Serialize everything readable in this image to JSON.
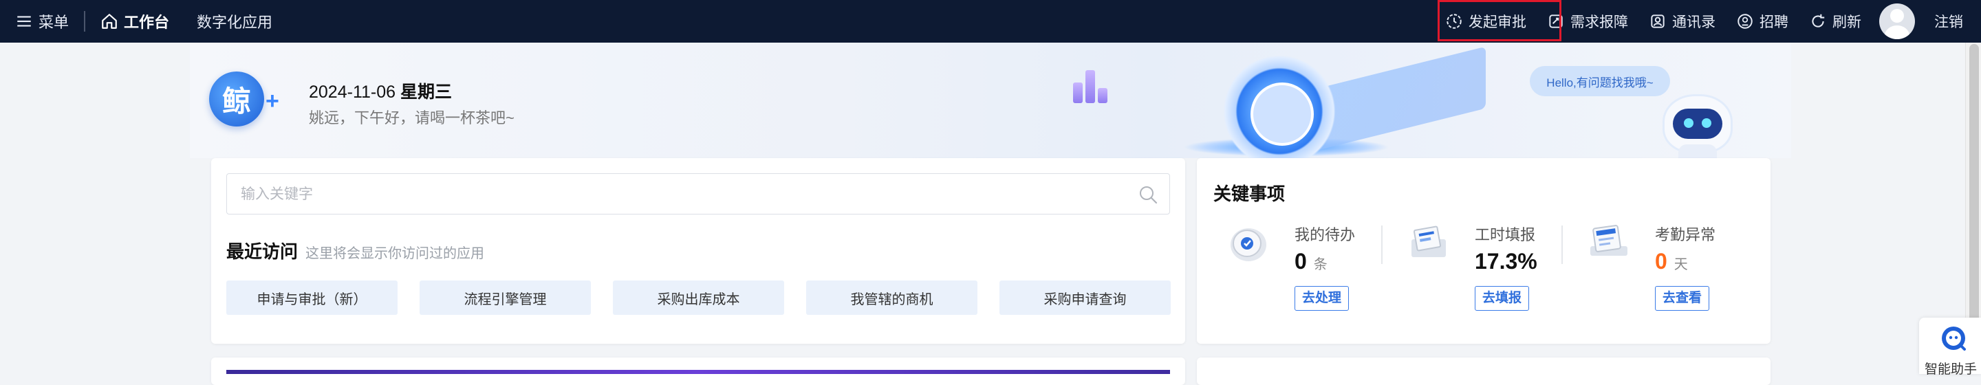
{
  "topbar": {
    "menu_label": "菜单",
    "workbench_label": "工作台",
    "digital_apps_label": "数字化应用",
    "actions": [
      {
        "label": "发起审批",
        "icon": "approval-icon"
      },
      {
        "label": "需求报障",
        "icon": "report-icon"
      },
      {
        "label": "通讯录",
        "icon": "contacts-icon"
      },
      {
        "label": "招聘",
        "icon": "recruit-icon"
      },
      {
        "label": "刷新",
        "icon": "refresh-icon"
      }
    ],
    "logout_label": "注销"
  },
  "banner": {
    "logo_text": "鲸",
    "date": "2024-11-06",
    "weekday": "星期三",
    "greeting": "姚远，下午好，请喝一杯茶吧~",
    "bubble": "Hello,有问题找我哦~"
  },
  "search": {
    "placeholder": "输入关键字",
    "value": ""
  },
  "recent": {
    "title": "最近访问",
    "hint": "这里将会显示你访问过的应用",
    "items": [
      "申请与审批（新）",
      "流程引擎管理",
      "采购出库成本",
      "我管辖的商机",
      "采购申请查询"
    ]
  },
  "key_items": {
    "title": "关键事项",
    "kpis": [
      {
        "label": "我的待办",
        "value": "0",
        "unit": "条",
        "button": "去处理"
      },
      {
        "label": "工时填报",
        "value": "17.3%",
        "unit": "",
        "button": "去填报"
      },
      {
        "label": "考勤异常",
        "value": "0",
        "unit": "天",
        "button": "去查看"
      }
    ]
  },
  "assistant": {
    "label": "智能助手"
  },
  "colors": {
    "topbar_bg": "#0d1a33",
    "accent": "#2f6fdc",
    "warn": "#ff6a1a",
    "highlight": "#e0192c"
  }
}
